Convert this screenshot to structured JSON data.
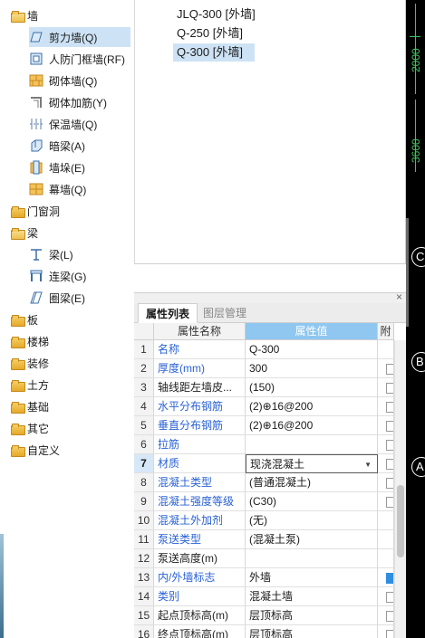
{
  "tree": {
    "groups": [
      {
        "label": "墙",
        "expanded": true,
        "children": [
          {
            "label": "剪力墙(Q)",
            "icon": "shear-wall-icon",
            "selected": true
          },
          {
            "label": "人防门框墙(RF)",
            "icon": "civil-defense-door-frame-wall-icon"
          },
          {
            "label": "砌体墙(Q)",
            "icon": "masonry-wall-icon"
          },
          {
            "label": "砌体加筋(Y)",
            "icon": "masonry-reinforcement-icon"
          },
          {
            "label": "保温墙(Q)",
            "icon": "insulation-wall-icon"
          },
          {
            "label": "暗梁(A)",
            "icon": "hidden-beam-icon"
          },
          {
            "label": "墙垛(E)",
            "icon": "wall-pier-icon"
          },
          {
            "label": "幕墙(Q)",
            "icon": "curtain-wall-icon"
          }
        ]
      },
      {
        "label": "门窗洞",
        "expanded": false
      },
      {
        "label": "梁",
        "expanded": true,
        "children": [
          {
            "label": "梁(L)",
            "icon": "beam-icon"
          },
          {
            "label": "连梁(G)",
            "icon": "coupling-beam-icon"
          },
          {
            "label": "圈梁(E)",
            "icon": "ring-beam-icon"
          }
        ]
      },
      {
        "label": "板",
        "expanded": false
      },
      {
        "label": "楼梯",
        "expanded": false
      },
      {
        "label": "装修",
        "expanded": false
      },
      {
        "label": "土方",
        "expanded": false
      },
      {
        "label": "基础",
        "expanded": false
      },
      {
        "label": "其它",
        "expanded": false
      },
      {
        "label": "自定义",
        "expanded": false
      }
    ]
  },
  "component_list": {
    "items": [
      {
        "label": "JLQ-300 [外墙]"
      },
      {
        "label": "Q-250 [外墙]"
      },
      {
        "label": "Q-300 [外墙]",
        "selected": true
      }
    ]
  },
  "property_panel": {
    "close_glyph": "×",
    "tabs": [
      {
        "label": "属性列表",
        "active": true
      },
      {
        "label": "图层管理",
        "active": false
      }
    ],
    "headers": {
      "num": "",
      "name": "属性名称",
      "value": "属性值",
      "attach": "附"
    },
    "rows": [
      {
        "num": "1",
        "name": "名称",
        "value": "Q-300",
        "blue": true,
        "checkbox": false
      },
      {
        "num": "2",
        "name": "厚度(mm)",
        "value": "300",
        "blue": true,
        "checkbox": true
      },
      {
        "num": "3",
        "name": "轴线距左墙皮...",
        "value": "(150)",
        "blue": false,
        "checkbox": true
      },
      {
        "num": "4",
        "name": "水平分布钢筋",
        "value": "(2)⊕16@200",
        "blue": true,
        "checkbox": true
      },
      {
        "num": "5",
        "name": "垂直分布钢筋",
        "value": "(2)⊕16@200",
        "blue": true,
        "checkbox": true
      },
      {
        "num": "6",
        "name": "拉筋",
        "value": "",
        "blue": true,
        "checkbox": true
      },
      {
        "num": "7",
        "name": "材质",
        "value": "现浇混凝土",
        "blue": true,
        "checkbox": true,
        "active": true,
        "dropdown": "▼"
      },
      {
        "num": "8",
        "name": "混凝土类型",
        "value": "(普通混凝土)",
        "blue": true,
        "checkbox": true
      },
      {
        "num": "9",
        "name": "混凝土强度等级",
        "value": "(C30)",
        "blue": true,
        "checkbox": true
      },
      {
        "num": "10",
        "name": "混凝土外加剂",
        "value": "(无)",
        "blue": true,
        "checkbox": false
      },
      {
        "num": "11",
        "name": "泵送类型",
        "value": "(混凝土泵)",
        "blue": true,
        "checkbox": false
      },
      {
        "num": "12",
        "name": "泵送高度(m)",
        "value": "",
        "blue": false,
        "checkbox": false
      },
      {
        "num": "13",
        "name": "内/外墙标志",
        "value": "外墙",
        "blue": true,
        "checkbox": true,
        "checked": true
      },
      {
        "num": "14",
        "name": "类别",
        "value": "混凝土墙",
        "blue": true,
        "checkbox": true
      },
      {
        "num": "15",
        "name": "起点顶标高(m)",
        "value": "层顶标高",
        "blue": false,
        "checkbox": true
      },
      {
        "num": "16",
        "name": "终点顶标高(m)",
        "value": "层顶标高",
        "blue": false,
        "checkbox": true
      }
    ]
  },
  "canvas": {
    "dims": [
      "2000",
      "3600"
    ],
    "axis_labels": [
      "C",
      "B",
      "A"
    ]
  },
  "colors": {
    "selection": "#cde3f5",
    "header_value_bg": "#8fc7f0",
    "blue_text": "#2a62d6",
    "canvas_bg": "#000000",
    "dim_green": "#3dc55a"
  }
}
